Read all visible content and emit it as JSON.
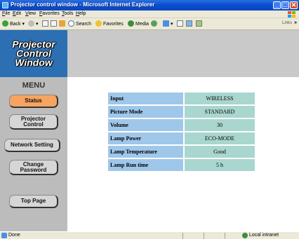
{
  "window": {
    "title": "Projector control window - Microsoft Internet Explorer",
    "controls": {
      "minimize": "_",
      "maximize": "□",
      "close": "✕"
    }
  },
  "menubar": {
    "items": [
      "File",
      "Edit",
      "View",
      "Favorites",
      "Tools",
      "Help"
    ]
  },
  "toolbar": {
    "back_label": "Back",
    "search_label": "Search",
    "favorites_label": "Favorites",
    "media_label": "Media",
    "links_label": "Links",
    "links_arrow": "»",
    "icons": [
      "back-icon",
      "forward-icon",
      "stop-icon",
      "refresh-icon",
      "home-icon",
      "search-icon",
      "favorites-icon",
      "media-icon",
      "history-icon",
      "mail-icon",
      "print-icon",
      "edit-icon"
    ]
  },
  "sidebar": {
    "logo_line1": "Projector",
    "logo_line2": "Control",
    "logo_line3": "Window",
    "menu_title": "MENU",
    "status_label": "Status",
    "projector_control_line1": "Projector",
    "projector_control_line2": "Control",
    "network_setting_label": "Network Setting",
    "change_password_line1": "Change",
    "change_password_line2": "Password",
    "top_page_label": "Top Page",
    "active_item": "Status",
    "active_color": "#f7a460"
  },
  "status_table": {
    "rows": [
      {
        "label": "Input",
        "value": "WIRELESS"
      },
      {
        "label": "Picture Mode",
        "value": "STANDARD"
      },
      {
        "label": "Volume",
        "value": "30"
      },
      {
        "label": "Lamp Power",
        "value": "ECO-MODE"
      },
      {
        "label": "Lamp Temperature",
        "value": "Good"
      },
      {
        "label": "Lamp Run time",
        "value": "5 h"
      }
    ],
    "label_color": "#9fc7ea",
    "value_color": "#a9d6cf"
  },
  "statusbar": {
    "status_text": "Done",
    "zone_text": "Local intranet"
  },
  "colors": {
    "titlebar": "#0a4fd1",
    "logo_panel": "#2c6fb3",
    "sidebar": "#bcbcbc"
  }
}
